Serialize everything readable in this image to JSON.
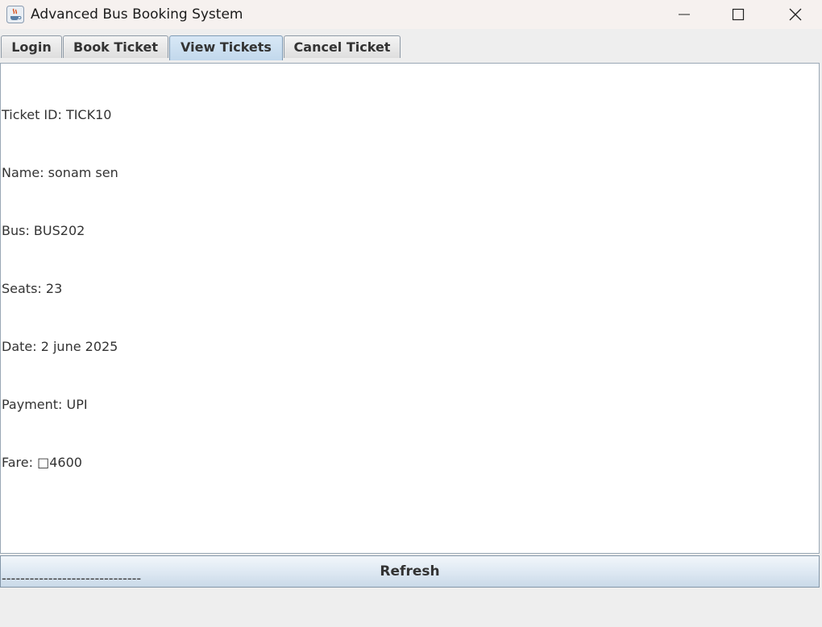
{
  "window": {
    "title": "Advanced Bus Booking System",
    "icon": "java-coffee-icon"
  },
  "tabs": [
    {
      "label": "Login",
      "selected": false
    },
    {
      "label": "Book Ticket",
      "selected": false
    },
    {
      "label": "View Tickets",
      "selected": true
    },
    {
      "label": "Cancel Ticket",
      "selected": false
    }
  ],
  "ticket_area": {
    "lines": [
      "Ticket ID: TICK10",
      "Name: sonam sen",
      "Bus: BUS202",
      "Seats: 23",
      "Date: 2 june 2025",
      "Payment: UPI",
      "Fare: □4600",
      "",
      "------------------------------"
    ]
  },
  "buttons": {
    "refresh": "Refresh"
  },
  "colors": {
    "selected_tab": "#c8dcee",
    "titlebar": "#f6f1ef"
  }
}
